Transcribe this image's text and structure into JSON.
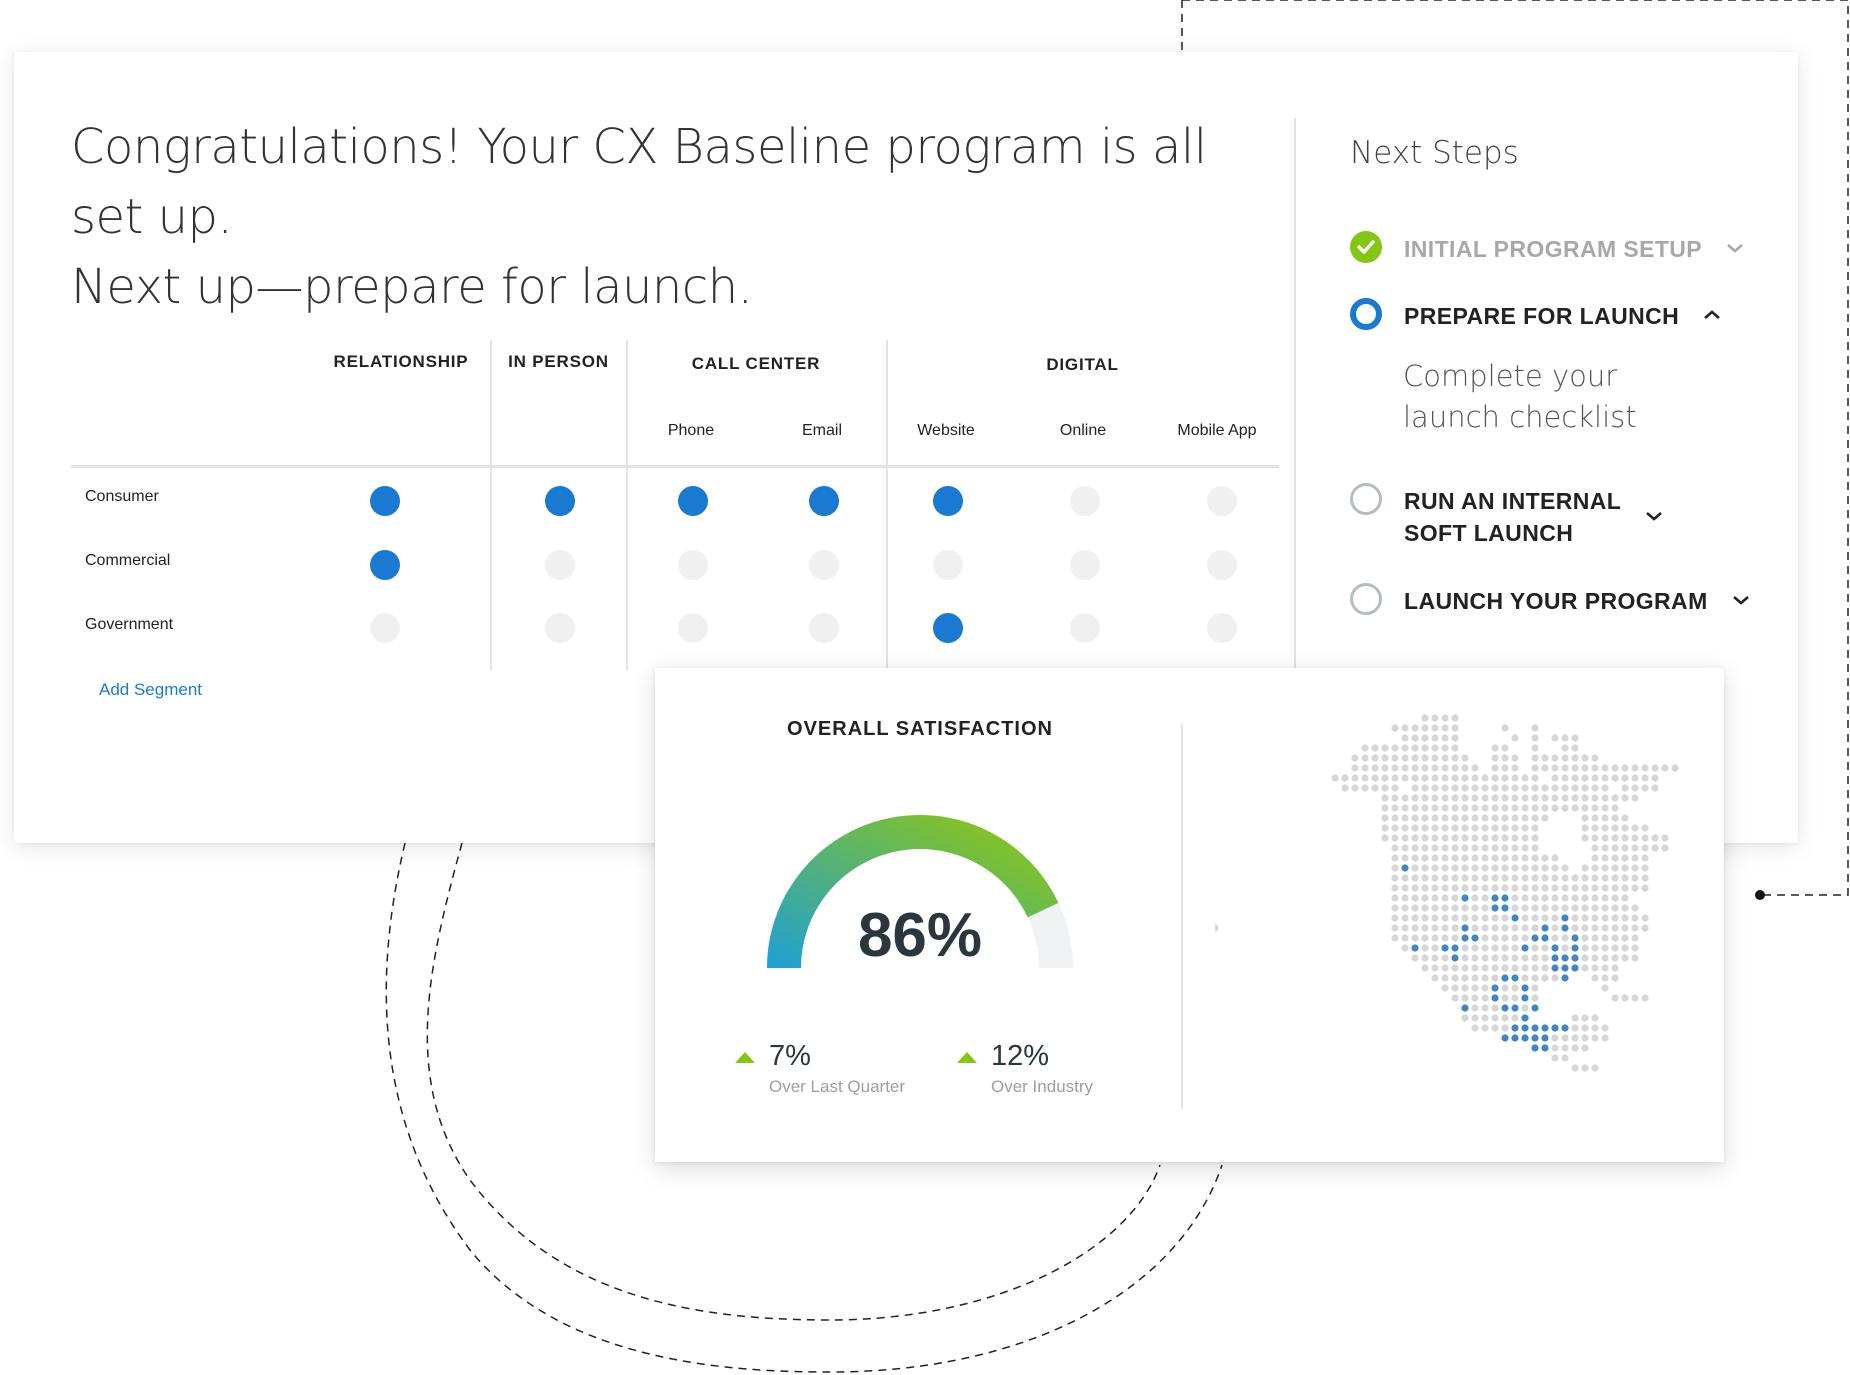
{
  "headline": {
    "line1": "Congratulations! Your CX Baseline program is all set up.",
    "line2": "Next up—prepare for launch."
  },
  "table": {
    "groups": [
      {
        "label": "RELATIONSHIP"
      },
      {
        "label": "IN PERSON"
      },
      {
        "label": "CALL CENTER"
      },
      {
        "label": "DIGITAL"
      }
    ],
    "channels": [
      "Phone",
      "Email",
      "Website",
      "Online",
      "Mobile App"
    ],
    "rows": [
      {
        "label": "Consumer",
        "values": [
          true,
          true,
          true,
          true,
          true,
          false,
          false
        ]
      },
      {
        "label": "Commercial",
        "values": [
          true,
          false,
          false,
          false,
          false,
          false,
          false
        ]
      },
      {
        "label": "Government",
        "values": [
          false,
          false,
          false,
          false,
          true,
          false,
          false
        ]
      }
    ],
    "add_segment_label": "Add Segment",
    "colors": {
      "active": "#1a7ad1",
      "inactive": "#f0f0f0"
    }
  },
  "next_steps": {
    "title": "Next Steps",
    "steps": [
      {
        "label": "INITIAL PROGRAM SETUP",
        "status": "complete",
        "expanded": false
      },
      {
        "label": "PREPARE FOR LAUNCH",
        "status": "active",
        "expanded": true,
        "description_line1": "Complete your",
        "description_line2": "launch checklist"
      },
      {
        "label_line1": "RUN AN INTERNAL",
        "label_line2": "SOFT LAUNCH",
        "status": "pending",
        "expanded": false
      },
      {
        "label": "LAUNCH YOUR PROGRAM",
        "status": "pending",
        "expanded": false
      }
    ]
  },
  "satisfaction": {
    "title": "OVERALL SATISFACTION",
    "value_label": "86%",
    "value": 0.86,
    "stats": [
      {
        "value": "7%",
        "caption": "Over Last Quarter",
        "direction": "up"
      },
      {
        "value": "12%",
        "caption": "Over Industry",
        "direction": "up"
      }
    ],
    "colors": {
      "gradient_start": "#22a0cf",
      "gradient_end": "#8dc616",
      "track": "#f0f1f2",
      "up": "#84c516"
    }
  },
  "map": {
    "region": "North America",
    "highlight_color": "#3f86c6",
    "base_color": "#d6d6d6"
  }
}
